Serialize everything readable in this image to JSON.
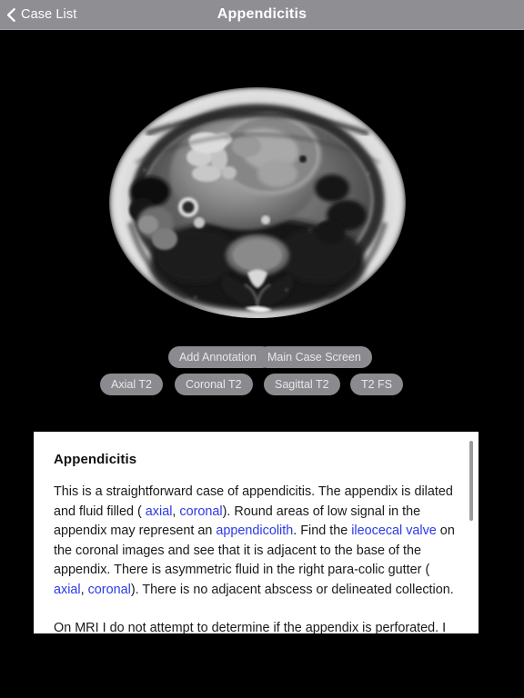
{
  "navbar": {
    "back_label": "Case List",
    "back_icon": "chevron-left-icon",
    "title": "Appendicitis",
    "background_color": "#8e8e93",
    "text_color": "#ffffff"
  },
  "viewer": {
    "background_color": "#000000",
    "image_description": "Axial T2 MRI of the abdomen and pelvis"
  },
  "buttons": {
    "row1": [
      {
        "id": "add-annotations",
        "label": "Add Annotations"
      },
      {
        "id": "main-case-screen",
        "label": "Main Case Screen"
      }
    ],
    "row2": [
      {
        "id": "axial-t2",
        "label": "Axial T2"
      },
      {
        "id": "coronal-t2",
        "label": "Coronal T2"
      },
      {
        "id": "sagittal-t2",
        "label": "Sagittal T2"
      },
      {
        "id": "t2-fs",
        "label": "T2 FS"
      }
    ],
    "background_color": "#8a8a8f",
    "text_color": "#e8e8ea"
  },
  "case_text": {
    "heading": "Appendicitis",
    "link_color": "#2b39e8",
    "paragraph1": {
      "s1": "This is a straightforward case of appendicitis. The appendix is dilated and fluid filled ( ",
      "link1": "axial",
      "s2": ", ",
      "link2": "coronal",
      "s3": "). Round areas of low signal in the appendix may represent an ",
      "link3": "appendicolith",
      "s4": ". Find the ",
      "link4": "ileocecal valve",
      "s5": " on the coronal images and see that it is adjacent to the base of the appendix. There is asymmetric fluid in the right para-colic gutter ( ",
      "link5": "axial",
      "s6": ", ",
      "link6": "coronal",
      "s7": "). There is no adjacent abscess or delineated collection."
    },
    "paragraph2": "On MRI I do not attempt to determine if the appendix is perforated. I note the presence of appendicitis and the presence or absence of an adjacent abscess. A recent study has suggested that there are not"
  }
}
